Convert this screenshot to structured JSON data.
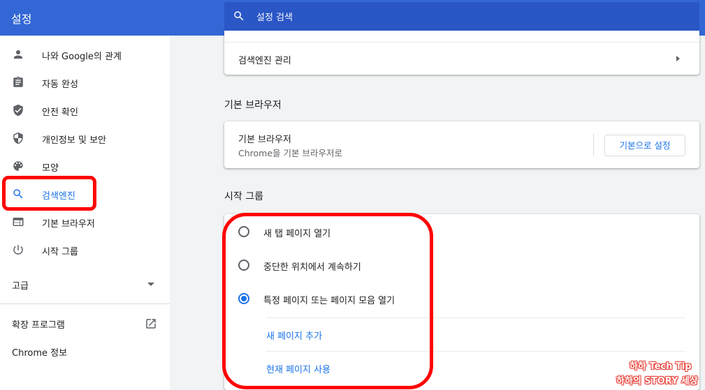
{
  "header": {
    "title": "설정",
    "search_placeholder": "설정 검색"
  },
  "sidebar": {
    "items": [
      {
        "label": "나와 Google의 관계",
        "icon": "person-icon"
      },
      {
        "label": "자동 완성",
        "icon": "clipboard-icon"
      },
      {
        "label": "안전 확인",
        "icon": "shield-check-icon"
      },
      {
        "label": "개인정보 및 보안",
        "icon": "shield-half-icon"
      },
      {
        "label": "모양",
        "icon": "palette-icon"
      },
      {
        "label": "검색엔진",
        "icon": "search-icon",
        "active": true
      },
      {
        "label": "기본 브라우저",
        "icon": "browser-window-icon"
      },
      {
        "label": "시작 그룹",
        "icon": "power-icon"
      }
    ],
    "advanced_label": "고급",
    "extensions_label": "확장 프로그램",
    "about_label": "Chrome 정보"
  },
  "search_engine_section": {
    "manage_label": "검색엔진 관리"
  },
  "default_browser_section": {
    "title": "기본 브라우저",
    "row_title": "기본 브라우저",
    "row_subtitle": "Chrome을 기본 브라우저로",
    "button_label": "기본으로 설정"
  },
  "startup_section": {
    "title": "시작 그룹",
    "options": [
      {
        "label": "새 탭 페이지 열기",
        "selected": false
      },
      {
        "label": "중단한 위치에서 계속하기",
        "selected": false
      },
      {
        "label": "특정 페이지 또는 페이지 모음 열기",
        "selected": true
      }
    ],
    "add_page_label": "새 페이지 추가",
    "use_current_label": "현재 페이지 사용"
  },
  "watermark": {
    "line1": "하하 Tech Tip",
    "line2": "하하의 STORY 세상"
  },
  "colors": {
    "header_blue": "#3367d6",
    "accent": "#1a73e8",
    "highlight_red": "#ff0000"
  }
}
